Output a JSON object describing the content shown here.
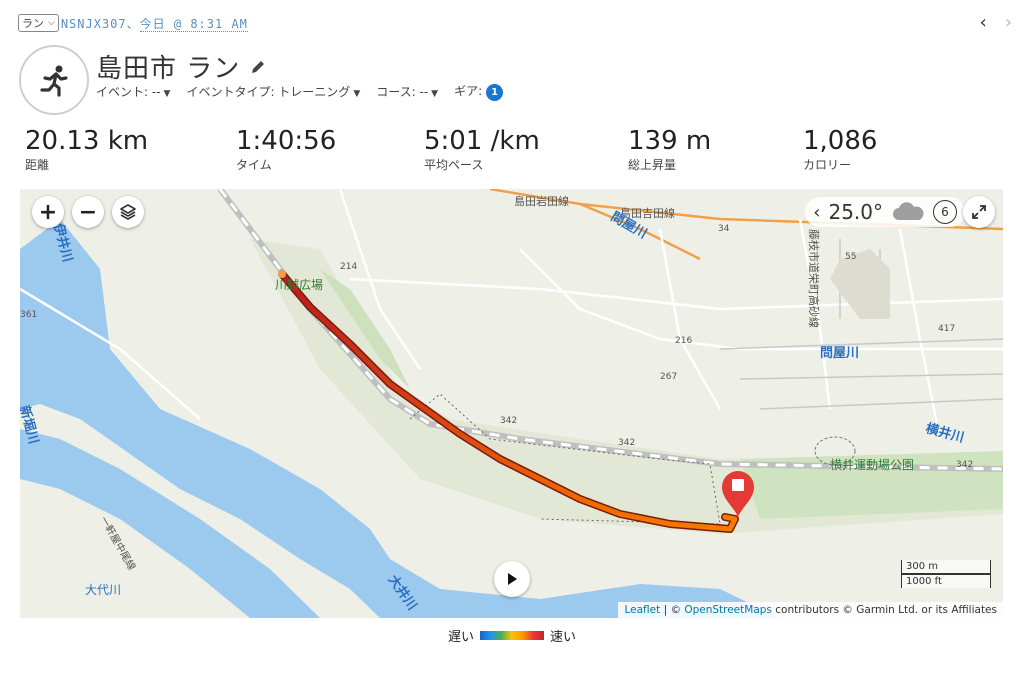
{
  "header": {
    "sport_select": "ラン",
    "activity_id": "NSNJX307",
    "separator": "、",
    "date": "今日 @ 8:31 AM",
    "title": "島田市 ラン",
    "event_label": "イベント: --",
    "event_type_label": "イベントタイプ: トレーニング",
    "course_label": "コース: --",
    "gear_label": "ギア:",
    "gear_count": "1"
  },
  "stats": [
    {
      "value": "20.13 km",
      "label": "距離"
    },
    {
      "value": "1:40:56",
      "label": "タイム"
    },
    {
      "value": "5:01 /km",
      "label": "平均ペース"
    },
    {
      "value": "139 m",
      "label": "総上昇量"
    },
    {
      "value": "1,086",
      "label": "カロリー"
    }
  ],
  "map": {
    "zoom_in": "+",
    "zoom_out": "−",
    "weather_temp": "25.0°",
    "wind_value": "6",
    "scale_metric": "300 m",
    "scale_imperial": "1000 ft",
    "attrib_leaflet": "Leaflet",
    "attrib_sep": " | © ",
    "attrib_osm": "OpenStreetMaps",
    "attrib_rest": " contributors © Garmin Ltd. or its Affiliates",
    "labels": {
      "rail1": "島田岩田線",
      "rail2": "島田吉田線",
      "river_toyaga1": "問屋川",
      "river_toyaga2": "問屋川",
      "rail3": "藤枝市道栄町高砂線",
      "kawahara": "川越広場",
      "yokoi_river": "横井川",
      "yokoi_park": "横井運動場公園",
      "oi_river": "大井川",
      "ioi_river": "伊井川",
      "nishi": "新堀川",
      "daidai": "大代川",
      "nankan": "一軒屋中尾線",
      "r342a": "342",
      "r342b": "342",
      "r342c": "342",
      "r216": "216",
      "r267": "267",
      "r34": "34",
      "r55": "55",
      "r361": "361",
      "r214": "214",
      "r417": "417"
    }
  },
  "legend": {
    "slow": "遅い",
    "fast": "速い"
  },
  "colors": {
    "accent": "#1976d2",
    "meta_link": "#5a8fc2",
    "river": "#9cc9ee",
    "route_start": "#d32f2f",
    "route_end": "#ff9800",
    "marker": "#e53935"
  }
}
